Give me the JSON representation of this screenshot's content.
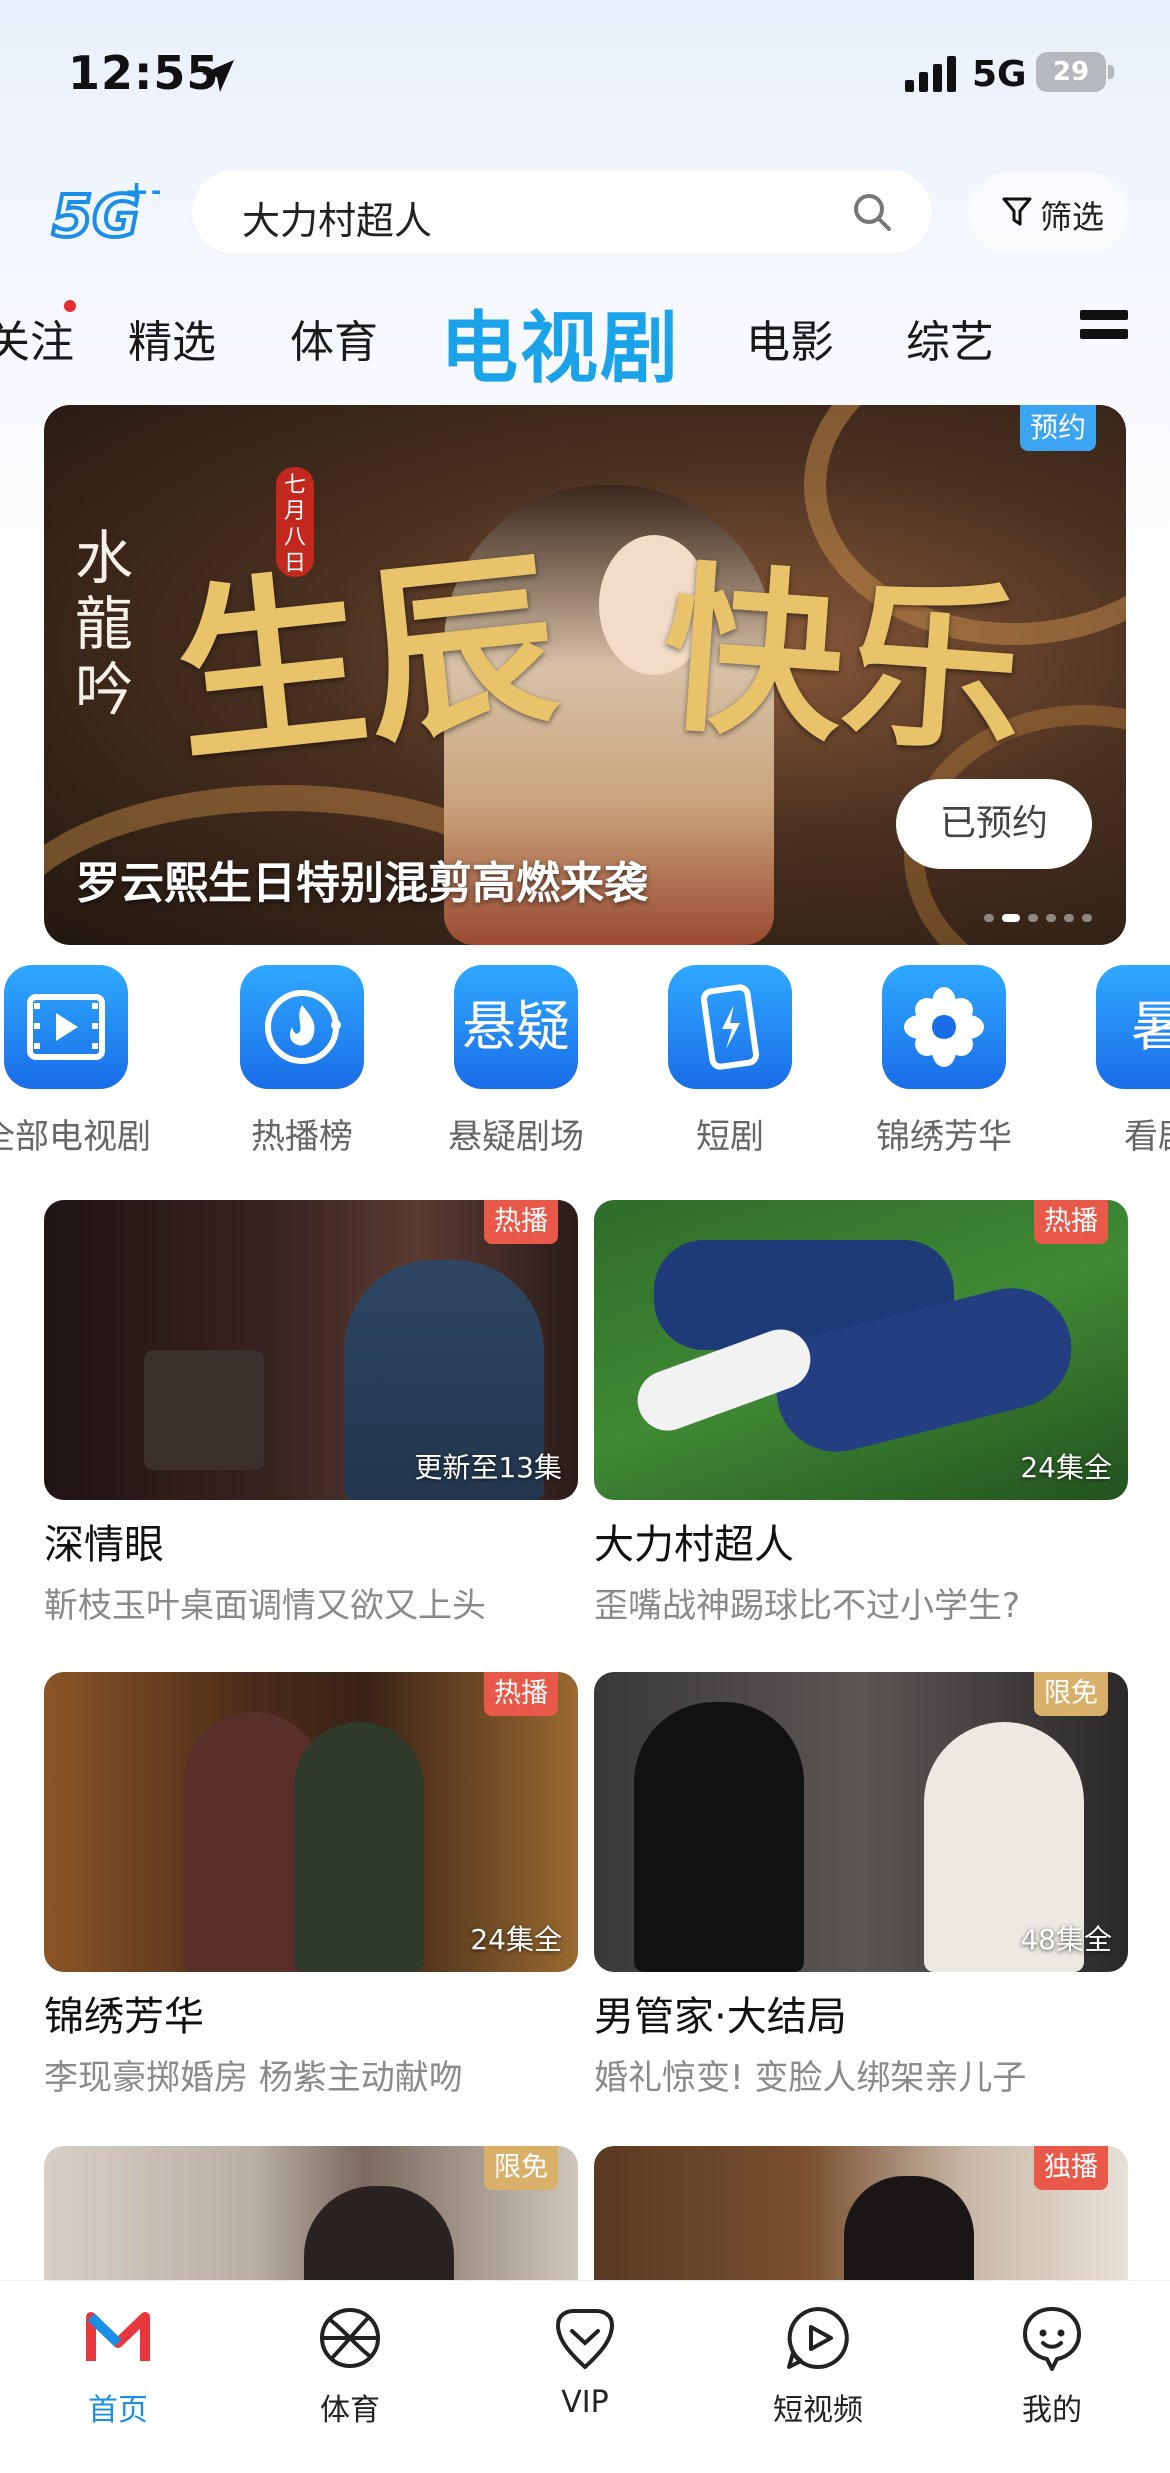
{
  "status_bar": {
    "time": "12:55",
    "network": "5G",
    "battery": "29"
  },
  "header": {
    "logo": "5G++",
    "search_value": "大力村超人",
    "filter_label": "筛选"
  },
  "tabs": [
    {
      "label": "关注",
      "has_dot": true
    },
    {
      "label": "精选"
    },
    {
      "label": "体育"
    },
    {
      "label": "电视剧",
      "active": true
    },
    {
      "label": "电影"
    },
    {
      "label": "综艺"
    }
  ],
  "banner": {
    "badge": "预约",
    "caption": "罗云熙生日特别混剪高燃来袭",
    "reserve_label": "已预约",
    "brand_text": "水龍吟",
    "seal_text": "七月八日",
    "headline": "生辰快乐",
    "slide_count": 6,
    "active_slide": 1
  },
  "categories": [
    {
      "label": "全部电视剧",
      "icon": "film-icon"
    },
    {
      "label": "热播榜",
      "icon": "flame-icon"
    },
    {
      "label": "悬疑剧场",
      "icon": "suspense-icon",
      "glyph": "悬疑"
    },
    {
      "label": "短剧",
      "icon": "phone-bolt-icon"
    },
    {
      "label": "锦绣芳华",
      "icon": "flower-icon"
    },
    {
      "label": "看剧",
      "icon": "summer-icon",
      "glyph": "暑"
    }
  ],
  "cards": [
    {
      "title": "深情眼",
      "subtitle": "靳枝玉叶桌面调情又欲又上头",
      "tag": "热播",
      "episodes": "更新至13集"
    },
    {
      "title": "大力村超人",
      "subtitle": "歪嘴战神踢球比不过小学生?",
      "tag": "热播",
      "episodes": "24集全"
    },
    {
      "title": "锦绣芳华",
      "subtitle": "李现豪掷婚房 杨紫主动献吻",
      "tag": "热播",
      "episodes": "24集全"
    },
    {
      "title": "男管家·大结局",
      "subtitle": "婚礼惊变! 变脸人绑架亲儿子",
      "tag": "限免",
      "episodes": "48集全"
    },
    {
      "title": "",
      "subtitle": "",
      "tag": "限免",
      "episodes": ""
    },
    {
      "title": "",
      "subtitle": "",
      "tag": "独播",
      "episodes": ""
    }
  ],
  "bottom_nav": [
    {
      "label": "首页",
      "icon": "home-logo-icon",
      "active": true
    },
    {
      "label": "体育",
      "icon": "basketball-icon"
    },
    {
      "label": "VIP",
      "icon": "vip-icon"
    },
    {
      "label": "短视频",
      "icon": "play-circle-icon"
    },
    {
      "label": "我的",
      "icon": "profile-icon"
    }
  ],
  "colors": {
    "accent": "#1aa3e8",
    "hot_tag": "#e8594a",
    "free_tag": "#d8b06a",
    "nav_active": "#1a8fe8"
  }
}
